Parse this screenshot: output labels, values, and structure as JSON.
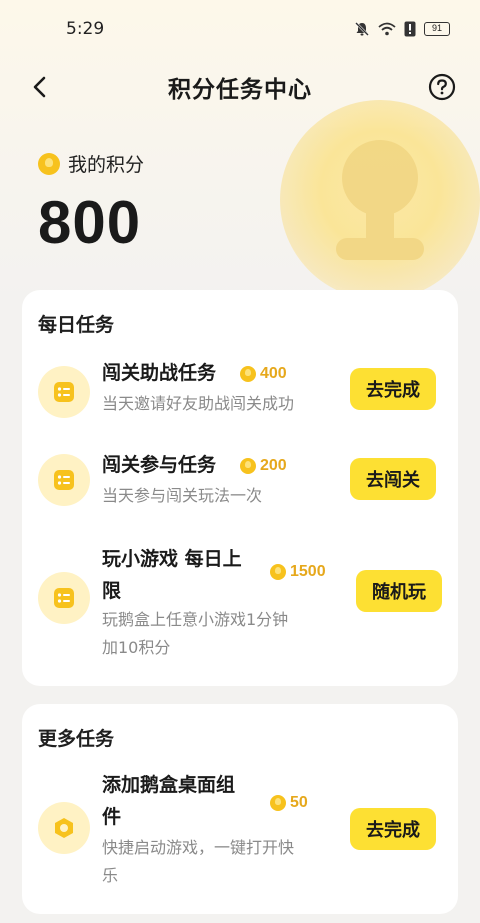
{
  "status_bar": {
    "time": "5:29",
    "battery": "91",
    "icons": [
      "mute-icon",
      "wifi-icon",
      "alert-icon",
      "battery-icon"
    ]
  },
  "header": {
    "title": "积分任务中心",
    "back_icon": "chevron-left-icon",
    "help_icon": "question-circle-icon"
  },
  "points": {
    "label": "我的积分",
    "value": "800",
    "coin_icon": "coin-icon"
  },
  "daily": {
    "title": "每日任务",
    "tasks": [
      {
        "name": "闯关助战任务",
        "reward": "400",
        "desc": "当天邀请好友助战闯关成功",
        "button": "去完成",
        "icon": "checklist-icon"
      },
      {
        "name": "闯关参与任务",
        "reward": "200",
        "desc": "当天参与闯关玩法一次",
        "button": "去闯关",
        "icon": "checklist-icon"
      },
      {
        "name_line1": "玩小游戏 每日上",
        "name_line2": "限",
        "reward": "1500",
        "desc_line1": "玩鹅盒上任意小游戏1分钟",
        "desc_line2": "加10积分",
        "button": "随机玩",
        "icon": "checklist-icon"
      }
    ]
  },
  "more": {
    "title": "更多任务",
    "tasks": [
      {
        "name_line1": "添加鹅盒桌面组",
        "name_line2": "件",
        "reward": "50",
        "desc_line1": "快捷启动游戏，一键打开快",
        "desc_line2": "乐",
        "button": "去完成",
        "icon": "widget-icon"
      }
    ]
  },
  "colors": {
    "accent_button": "#fde033",
    "reward_text": "#e6a81c",
    "coin": "#f7c21d",
    "icon_bg": "#fff2c4"
  }
}
